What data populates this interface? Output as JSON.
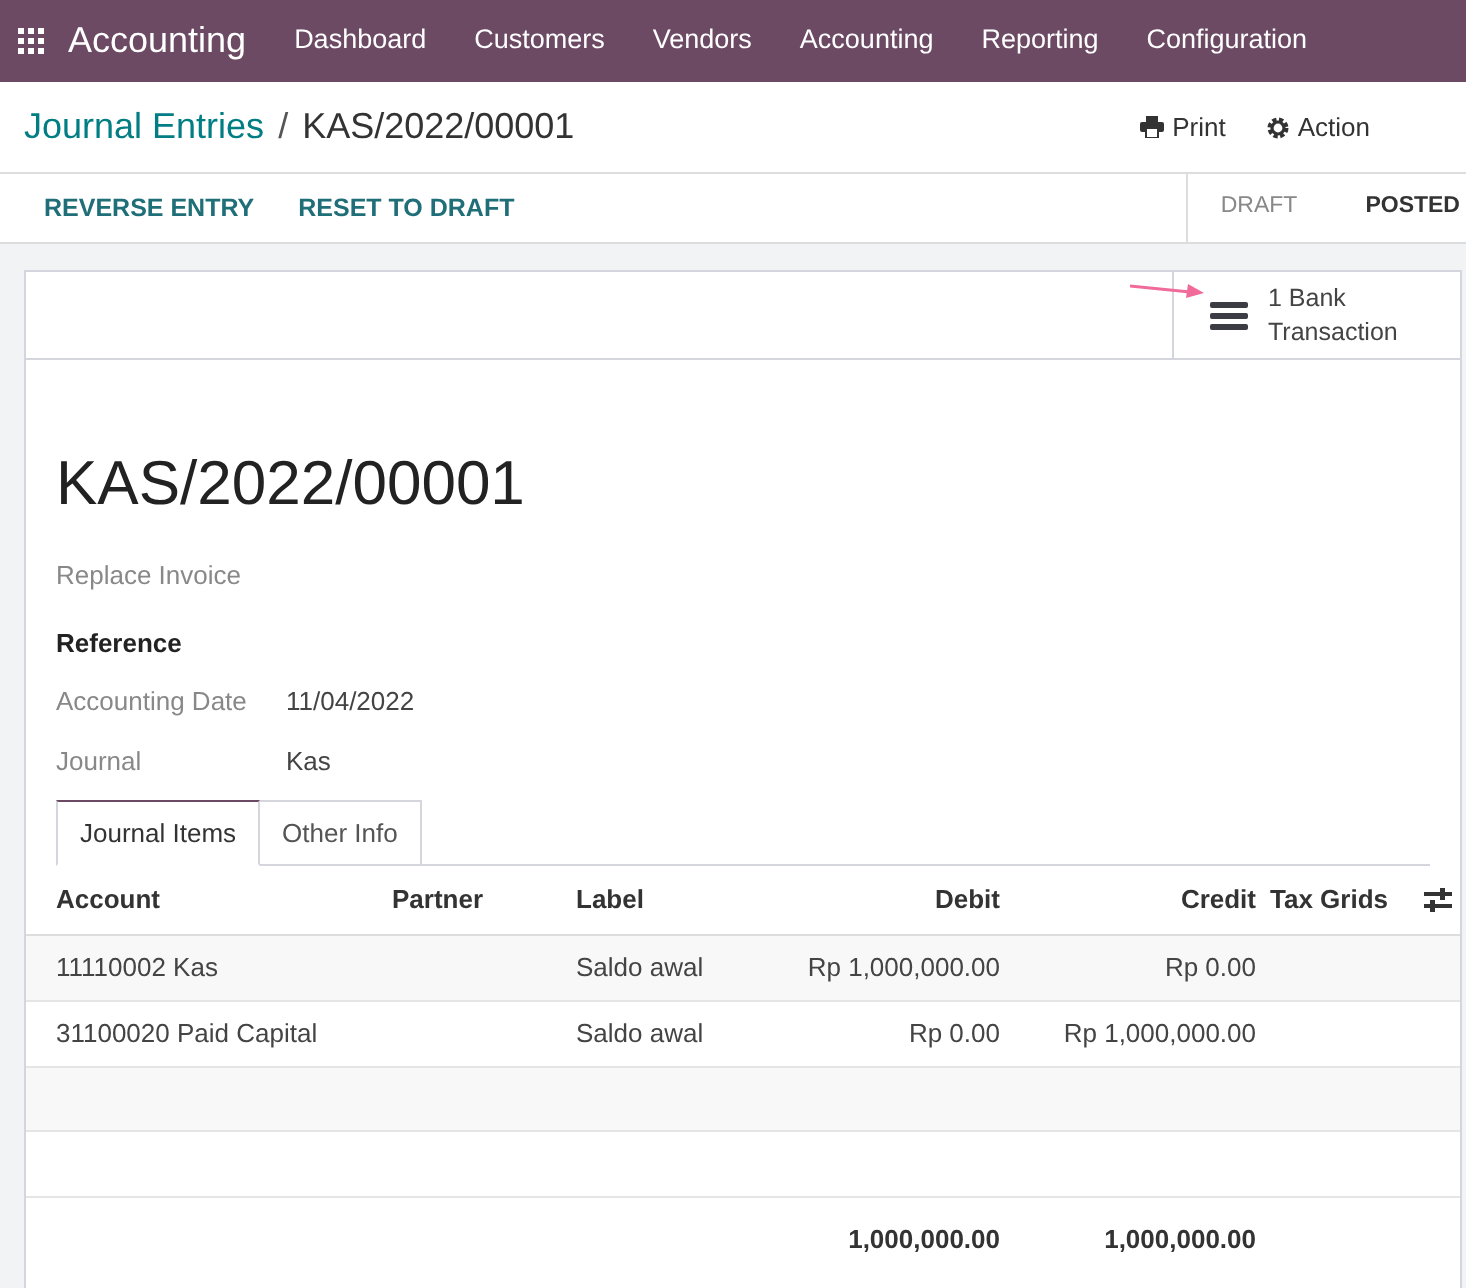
{
  "navbar": {
    "app_name": "Accounting",
    "menu": [
      "Dashboard",
      "Customers",
      "Vendors",
      "Accounting",
      "Reporting",
      "Configuration"
    ]
  },
  "breadcrumb": {
    "parent": "Journal Entries",
    "separator": "/",
    "current": "KAS/2022/00001"
  },
  "actions": [
    "Print",
    "Action"
  ],
  "buttons": [
    "REVERSE ENTRY",
    "RESET TO DRAFT"
  ],
  "status_steps": [
    {
      "label": "DRAFT",
      "selected": false
    },
    {
      "label": "POSTED",
      "selected": true
    }
  ],
  "smart_button": {
    "line1": "1 Bank",
    "line2": "Transaction"
  },
  "title": "KAS/2022/00001",
  "subtitle": "Replace Invoice",
  "reference_label": "Reference",
  "fields": [
    {
      "label": "Accounting Date",
      "value": "11/04/2022"
    },
    {
      "label": "Journal",
      "value": "Kas"
    }
  ],
  "tabs": [
    {
      "label": "Journal Items",
      "selected": true
    },
    {
      "label": "Other Info",
      "selected": false
    }
  ],
  "table": {
    "columns": [
      "Account",
      "Partner",
      "Label",
      "Debit",
      "Credit",
      "Tax Grids"
    ],
    "rows": [
      {
        "account": "11110002 Kas",
        "partner": "",
        "label": "Saldo awal",
        "debit": "Rp 1,000,000.00",
        "credit": "Rp 0.00"
      },
      {
        "account": "31100020 Paid Capital",
        "partner": "",
        "label": "Saldo awal",
        "debit": "Rp 0.00",
        "credit": "Rp 1,000,000.00"
      }
    ],
    "totals": {
      "debit": "1,000,000.00",
      "credit": "1,000,000.00"
    }
  }
}
